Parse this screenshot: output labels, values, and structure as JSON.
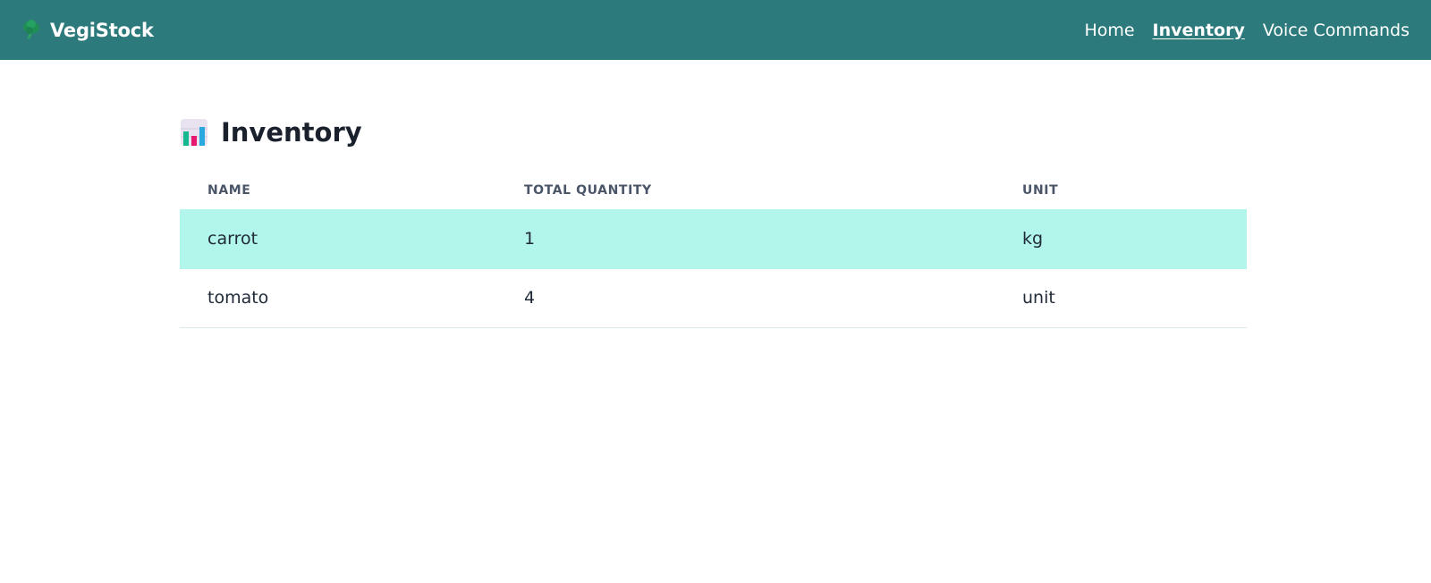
{
  "app": {
    "brand": "VegiStock",
    "brand_icon": "broccoli-icon",
    "colors": {
      "navbar": "#2c7a7b",
      "highlight_row": "#b2f5ea",
      "title_text": "#1a202c"
    }
  },
  "nav": {
    "items": [
      {
        "label": "Home",
        "active": false
      },
      {
        "label": "Inventory",
        "active": true
      },
      {
        "label": "Voice Commands",
        "active": false
      }
    ]
  },
  "page": {
    "title": "Inventory",
    "title_icon": "bar-chart-icon"
  },
  "table": {
    "columns": [
      "NAME",
      "TOTAL QUANTITY",
      "UNIT"
    ],
    "rows": [
      {
        "name": "carrot",
        "quantity": "1",
        "unit": "kg",
        "highlighted": true
      },
      {
        "name": "tomato",
        "quantity": "4",
        "unit": "unit",
        "highlighted": false
      }
    ]
  }
}
